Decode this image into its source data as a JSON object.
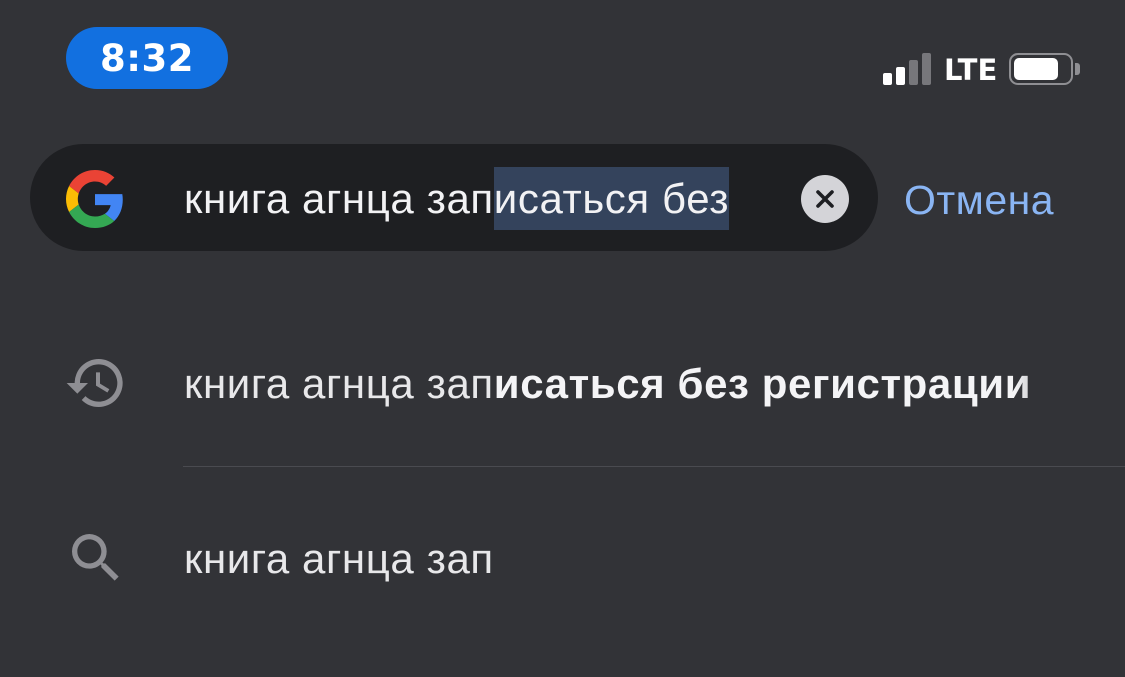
{
  "status_bar": {
    "time": "8:32",
    "network": "LTE",
    "signal_bars_active": 2,
    "signal_bars_total": 4,
    "battery_level": 0.8,
    "time_pill_color": "#1270e0"
  },
  "search": {
    "query_unselected": "книга агнца зап",
    "query_selected": "исаться без",
    "logo_icon": "google-g-icon",
    "clear_icon": "clear-icon",
    "cancel_label": "Отмена"
  },
  "suggestions": [
    {
      "icon": "history-icon",
      "prefix": "книга агнца зап",
      "bold": "исаться без регистрации"
    },
    {
      "icon": "search-icon",
      "prefix": "книга агнца зап",
      "bold": ""
    }
  ],
  "colors": {
    "background": "#323337",
    "search_field": "#1e1f22",
    "accent": "#8ab5f3",
    "selection": "#34435c"
  }
}
